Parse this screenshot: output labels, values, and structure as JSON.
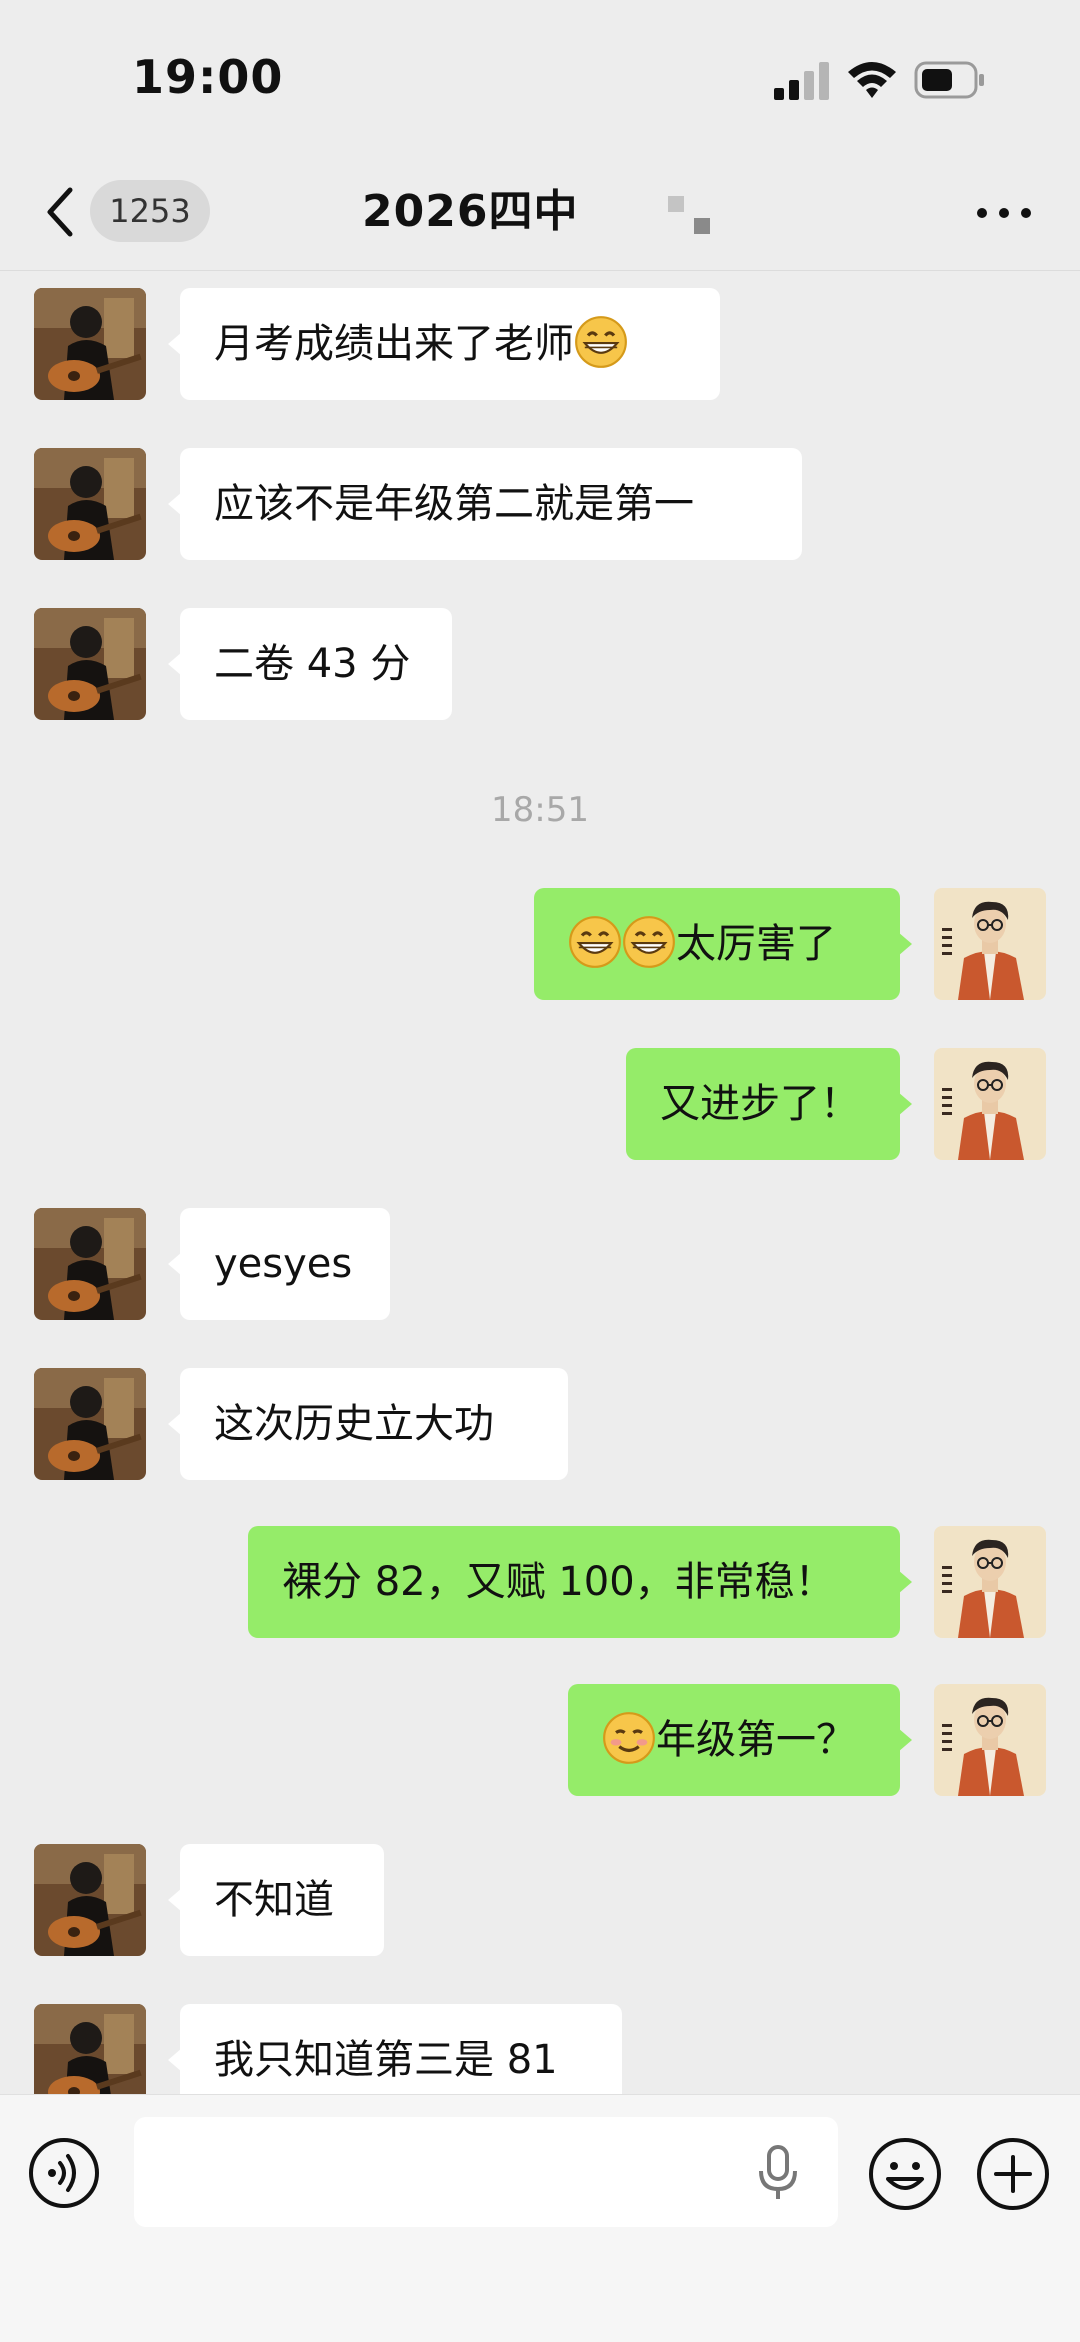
{
  "status_bar": {
    "time": "19:00"
  },
  "header": {
    "back_count": "1253",
    "title": "2026四中",
    "icons": [
      "back-chevron-icon",
      "more-icon"
    ]
  },
  "messages": [
    {
      "side": "in",
      "text": "月考成绩出来了老师",
      "emoji_after": "grin"
    },
    {
      "side": "in",
      "text": "应该不是年级第二就是第一"
    },
    {
      "side": "in",
      "text": "二卷 43 分"
    },
    {
      "side": "out",
      "text": "太厉害了",
      "emoji_before": [
        "grin",
        "grin"
      ]
    },
    {
      "side": "out",
      "text": "又进步了！"
    },
    {
      "side": "in",
      "text": "yesyes"
    },
    {
      "side": "in",
      "text": "这次历史立大功"
    },
    {
      "side": "out",
      "text": "裸分 82，又赋 100，非常稳！"
    },
    {
      "side": "out",
      "text": "年级第一？",
      "emoji_before": [
        "smirk"
      ]
    },
    {
      "side": "in",
      "text": "不知道"
    },
    {
      "side": "in",
      "text": "我只知道第三是 81"
    }
  ],
  "timestamp": "18:51",
  "input_bar": {
    "icons": [
      "voice-icon",
      "microphone-icon",
      "emoji-icon",
      "plus-icon"
    ]
  },
  "colors": {
    "background": "#ededed",
    "outgoing_bubble": "#95ec69",
    "incoming_bubble": "#ffffff"
  }
}
